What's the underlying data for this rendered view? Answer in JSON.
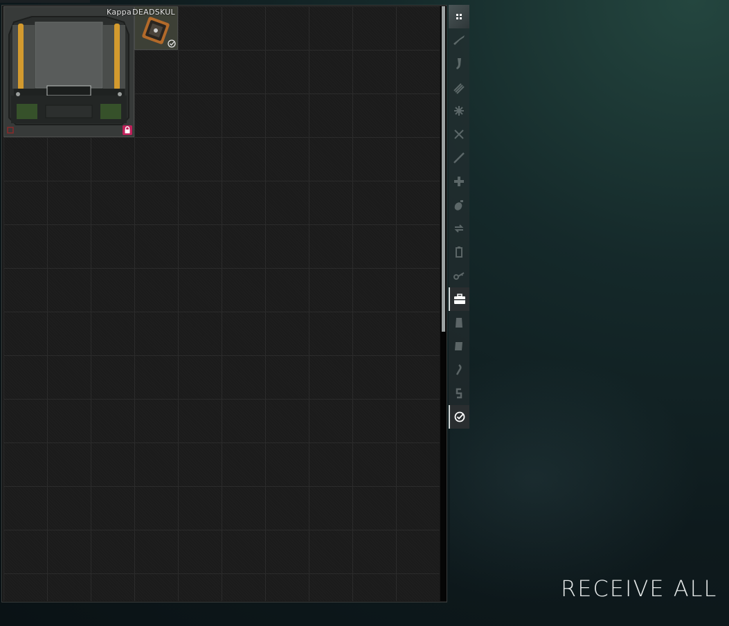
{
  "stash": {
    "items": [
      {
        "label": "Kappa",
        "icon": "kappa-container-icon",
        "badge": "lock-icon"
      },
      {
        "label": "DEADSKUL",
        "icon": "deadskul-lockbox-icon",
        "badge": "check-icon"
      }
    ]
  },
  "sidebar": {
    "tabs": [
      {
        "icon": "grid-icon",
        "state": "active"
      },
      {
        "icon": "rifle-icon"
      },
      {
        "icon": "magazine-icon"
      },
      {
        "icon": "ammo-icon"
      },
      {
        "icon": "gear-icon"
      },
      {
        "icon": "melee-icon"
      },
      {
        "icon": "knife-icon"
      },
      {
        "icon": "medical-icon"
      },
      {
        "icon": "grenade-icon"
      },
      {
        "icon": "barter-icon"
      },
      {
        "icon": "battery-icon"
      },
      {
        "icon": "keys-icon"
      },
      {
        "icon": "container-icon",
        "state": "selected"
      },
      {
        "icon": "armor-icon"
      },
      {
        "icon": "info-icon"
      },
      {
        "icon": "food-icon"
      },
      {
        "icon": "money-icon"
      },
      {
        "icon": "check-icon",
        "state": "selected"
      }
    ]
  },
  "actions": {
    "receive_all_label": "RECEIVE ALL"
  },
  "colors": {
    "accent": "#e8ecec",
    "lock_badge": "#c0205a",
    "background": "#0e1a1d"
  }
}
